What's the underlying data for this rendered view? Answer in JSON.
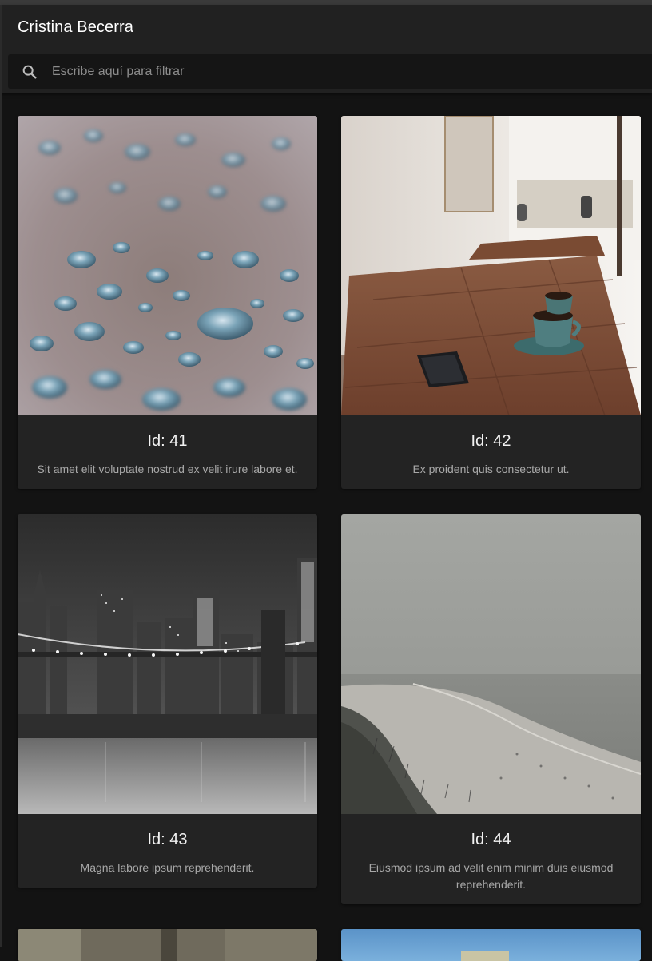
{
  "app": {
    "title": "Cristina Becerra"
  },
  "search": {
    "placeholder": "Escribe aquí para filtrar",
    "value": ""
  },
  "cards": [
    {
      "title": "Id: 41",
      "description": "Sit amet elit voluptate nostrud ex velit irure labore et.",
      "image": "water-droplets-photo"
    },
    {
      "title": "Id: 42",
      "description": "Ex proident quis consectetur ut.",
      "image": "cafe-table-coffee-photo"
    },
    {
      "title": "Id: 43",
      "description": "Magna labore ipsum reprehenderit.",
      "image": "city-bridge-night-photo"
    },
    {
      "title": "Id: 44",
      "description": "Eiusmod ipsum ad velit enim minim duis eiusmod reprehenderit.",
      "image": "foggy-beach-photo"
    }
  ],
  "colors": {
    "background": "#131313",
    "header": "#212121",
    "card": "#232323"
  }
}
